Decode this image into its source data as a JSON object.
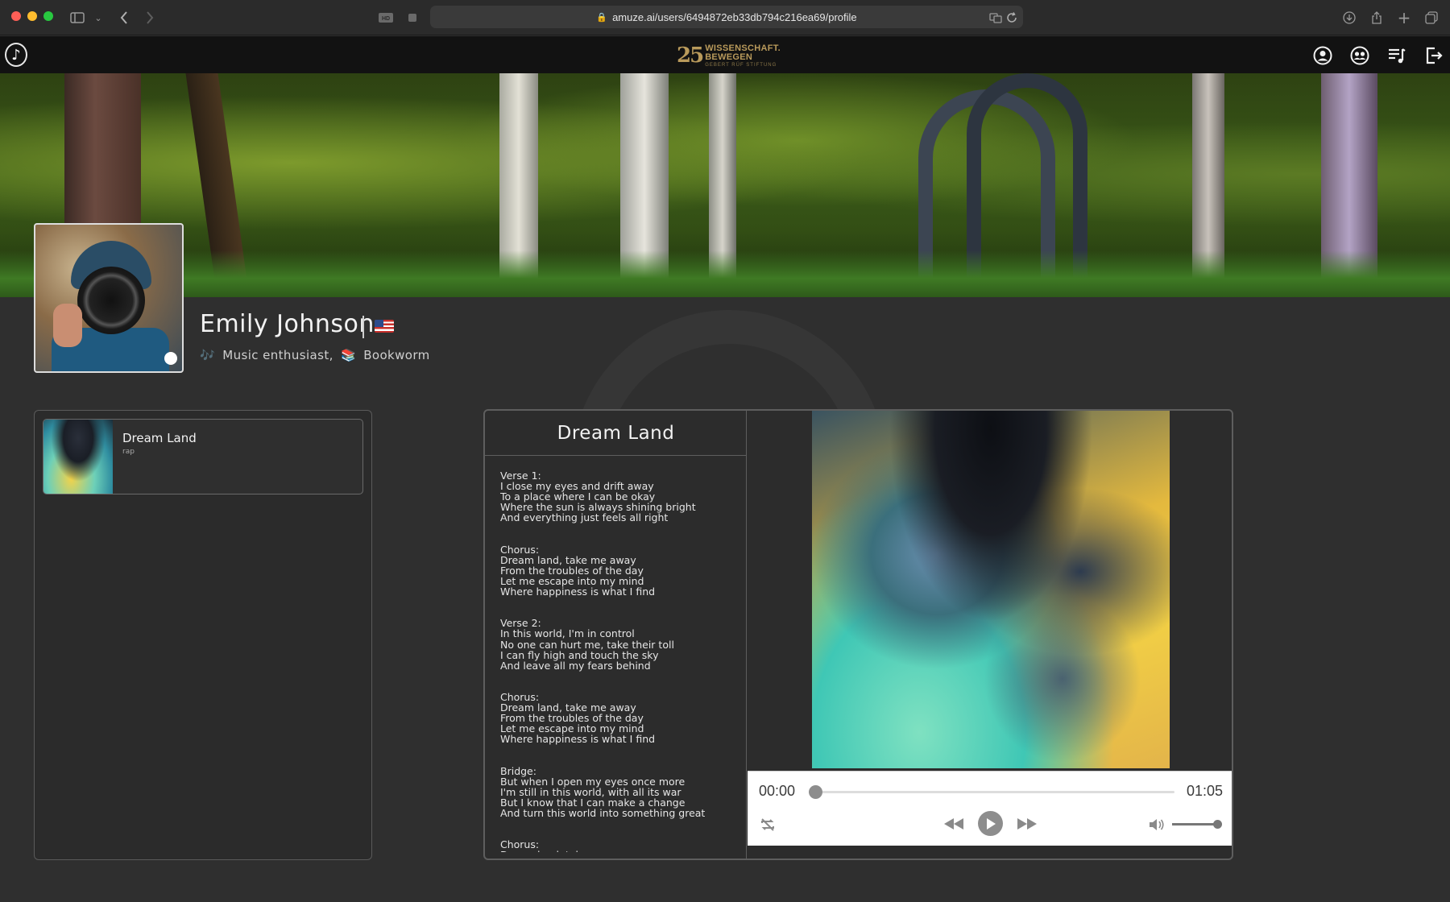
{
  "browser": {
    "url": "amuze.ai/users/6494872eb33db794c216ea69/profile",
    "traffic_colors": [
      "#ff5f57",
      "#febc2e",
      "#28c840"
    ]
  },
  "sponsor": {
    "badge": "25",
    "line1": "WISSENSCHAFT.",
    "line2": "BEWEGEN",
    "line3": "GEBERT RÜF STIFTUNG"
  },
  "nav_icons": [
    "profile-icon",
    "community-icon",
    "playlist-icon",
    "logout-icon"
  ],
  "profile": {
    "name": "Emily Johnson",
    "flag": "us-flag",
    "bio_item_1": "Music enthusiast,",
    "bio_item_2": "Bookworm",
    "online_status": "online"
  },
  "song_list": {
    "items": [
      {
        "title": "Dream Land",
        "genre": "rap"
      }
    ]
  },
  "player": {
    "title": "Dream Land",
    "lyrics": "Verse 1:\nI close my eyes and drift away\nTo a place where I can be okay\nWhere the sun is always shining bright\nAnd everything just feels all right\n\n\nChorus:\nDream land, take me away\nFrom the troubles of the day\nLet me escape into my mind\nWhere happiness is what I find\n\n\nVerse 2:\nIn this world, I'm in control\nNo one can hurt me, take their toll\nI can fly high and touch the sky\nAnd leave all my fears behind\n\n\nChorus:\nDream land, take me away\nFrom the troubles of the day\nLet me escape into my mind\nWhere happiness is what I find\n\n\nBridge:\nBut when I open my eyes once more\nI'm still in this world, with all its war\nBut I know that I can make a change\nAnd turn this world into something great\n\n\nChorus:\nDream land, take me away\nFrom the troubles of the day\nLet me escape into my mind",
    "current_time": "00:00",
    "duration": "01:05",
    "progress": 0,
    "volume": 1.0
  }
}
